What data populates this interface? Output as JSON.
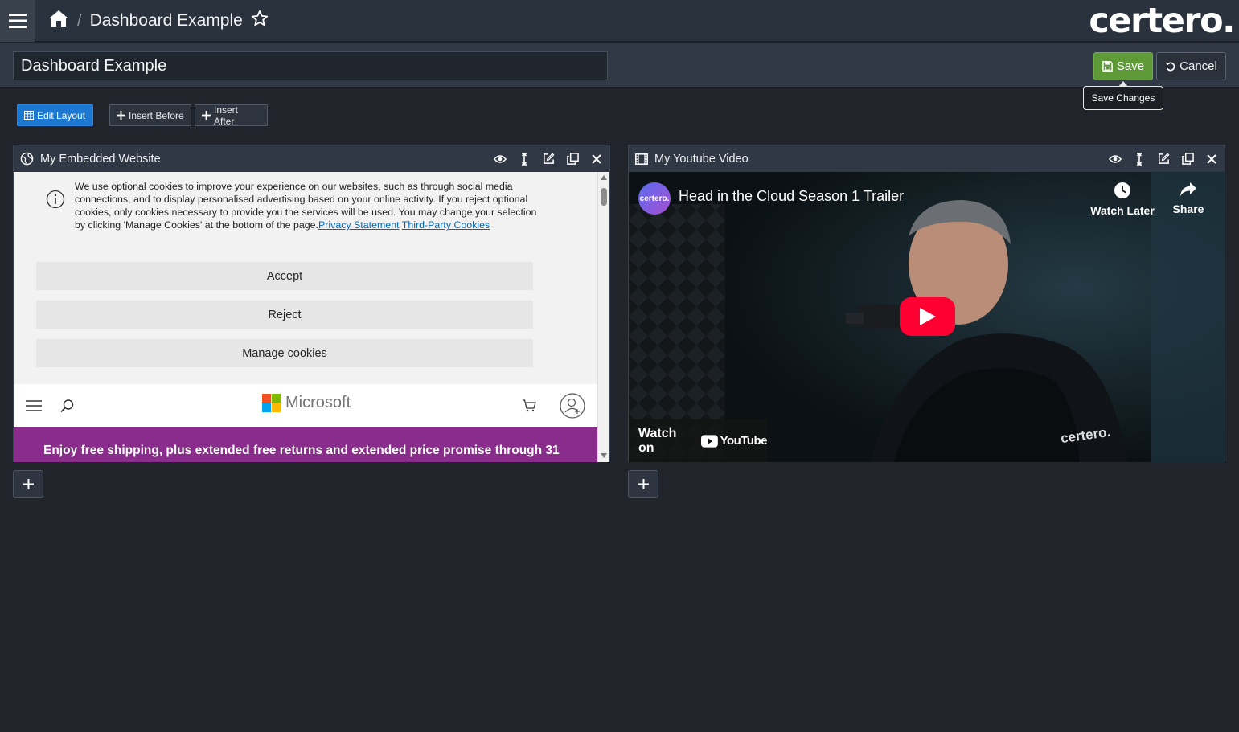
{
  "topbar": {
    "breadcrumb_title": "Dashboard Example",
    "logo_text": "certero."
  },
  "titlebar": {
    "title_value": "Dashboard Example",
    "save_label": "Save",
    "cancel_label": "Cancel",
    "save_tooltip": "Save Changes"
  },
  "toolbar": {
    "edit_layout": "Edit Layout",
    "insert_before": "Insert Before",
    "insert_after": "Insert After"
  },
  "panels": [
    {
      "title": "My Embedded Website",
      "cookie": {
        "text": "We use optional cookies to improve your experience on our websites, such as through social media connections, and to display personalised advertising based on your online activity. If you reject optional cookies, only cookies necessary to provide you the services will be used. You may change your selection by clicking 'Manage Cookies' at the bottom of the page.",
        "privacy_link": "Privacy Statement",
        "third_party_link": "Third-Party Cookies",
        "accept": "Accept",
        "reject": "Reject",
        "manage": "Manage cookies"
      },
      "site": {
        "brand": "Microsoft",
        "promo": "Enjoy free shipping, plus extended free returns and extended price promise through 31"
      }
    },
    {
      "title": "My Youtube Video",
      "video": {
        "channel": "certero.",
        "title": "Head in the Cloud Season 1 Trailer",
        "watch_later": "Watch Later",
        "share": "Share",
        "watch_on": "Watch on",
        "youtube": "YouTube",
        "jacket_text": "certero."
      }
    }
  ],
  "colors": {
    "accent_blue": "#1c78d0",
    "save_green": "#5e9a38",
    "youtube_red": "#ff0033",
    "promo_purple": "#8a2c8b"
  }
}
